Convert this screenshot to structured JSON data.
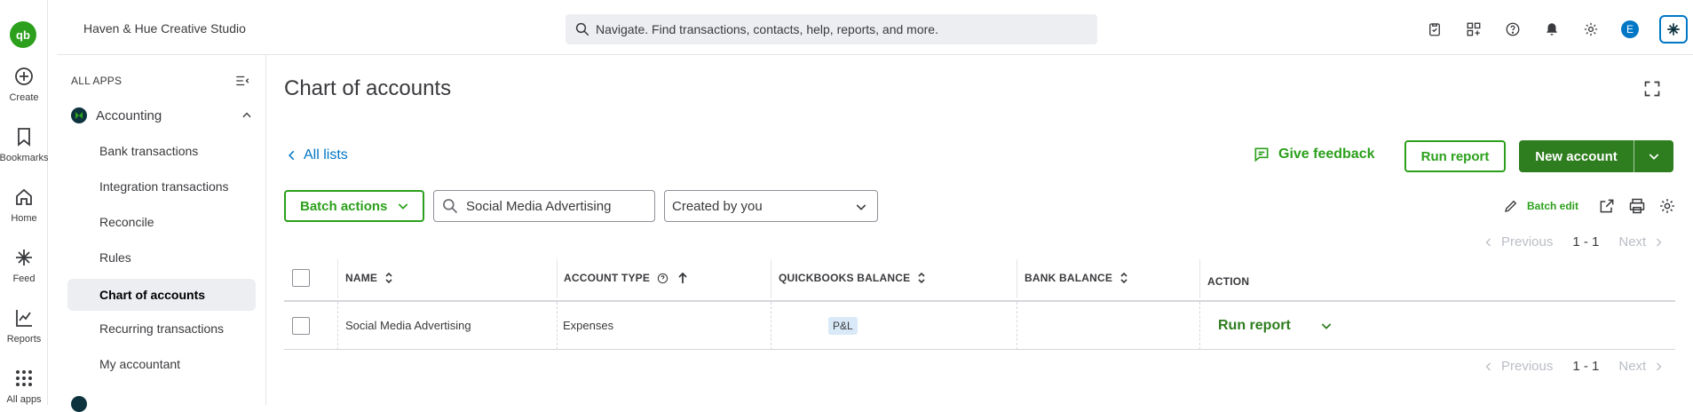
{
  "colors": {
    "brand_green": "#2ca01c",
    "dark_green": "#2e7d1e",
    "link_blue": "#0077c5",
    "text": "#393a3d",
    "border": "#d4d7dc"
  },
  "rail": {
    "logo_text": "qb",
    "items": [
      {
        "label": "Create",
        "icon": "plus-circle-icon"
      },
      {
        "label": "Bookmarks",
        "icon": "bookmark-icon"
      },
      {
        "label": "Home",
        "icon": "home-icon"
      },
      {
        "label": "Feed",
        "icon": "sparkle-icon"
      },
      {
        "label": "Reports",
        "icon": "line-chart-icon"
      },
      {
        "label": "All apps",
        "icon": "grid-icon"
      }
    ]
  },
  "topbar": {
    "company": "Haven & Hue Creative Studio",
    "search_placeholder": "Navigate. Find transactions, contacts, help, reports, and more.",
    "user_initial": "E",
    "icons": [
      "clipboard-icon",
      "apps-icon",
      "help-icon",
      "bell-icon",
      "gear-icon",
      "user-avatar",
      "assistant-icon"
    ]
  },
  "sidebar": {
    "header": "ALL APPS",
    "section": "Accounting",
    "items": [
      {
        "label": "Bank transactions",
        "active": false
      },
      {
        "label": "Integration transactions",
        "active": false
      },
      {
        "label": "Reconcile",
        "active": false
      },
      {
        "label": "Rules",
        "active": false
      },
      {
        "label": "Chart of accounts",
        "active": true
      },
      {
        "label": "Recurring transactions",
        "active": false
      },
      {
        "label": "My accountant",
        "active": false
      }
    ]
  },
  "main": {
    "title": "Chart of accounts",
    "all_lists": "All lists",
    "feedback": "Give feedback",
    "run_report": "Run report",
    "new_account": "New account",
    "batch_actions": "Batch actions",
    "search_value": "Social Media Advertising",
    "filter_value": "Created by you",
    "batch_edit": "Batch edit",
    "pager": {
      "previous": "Previous",
      "range": "1 - 1",
      "next": "Next"
    }
  },
  "table": {
    "columns": [
      "NAME",
      "ACCOUNT TYPE",
      "QUICKBOOKS BALANCE",
      "BANK BALANCE",
      "ACTION"
    ],
    "rows": [
      {
        "name": "Social Media Advertising",
        "account_type": "Expenses",
        "badge": "P&L",
        "quickbooks_balance": "",
        "bank_balance": "",
        "action": "Run report"
      }
    ]
  }
}
